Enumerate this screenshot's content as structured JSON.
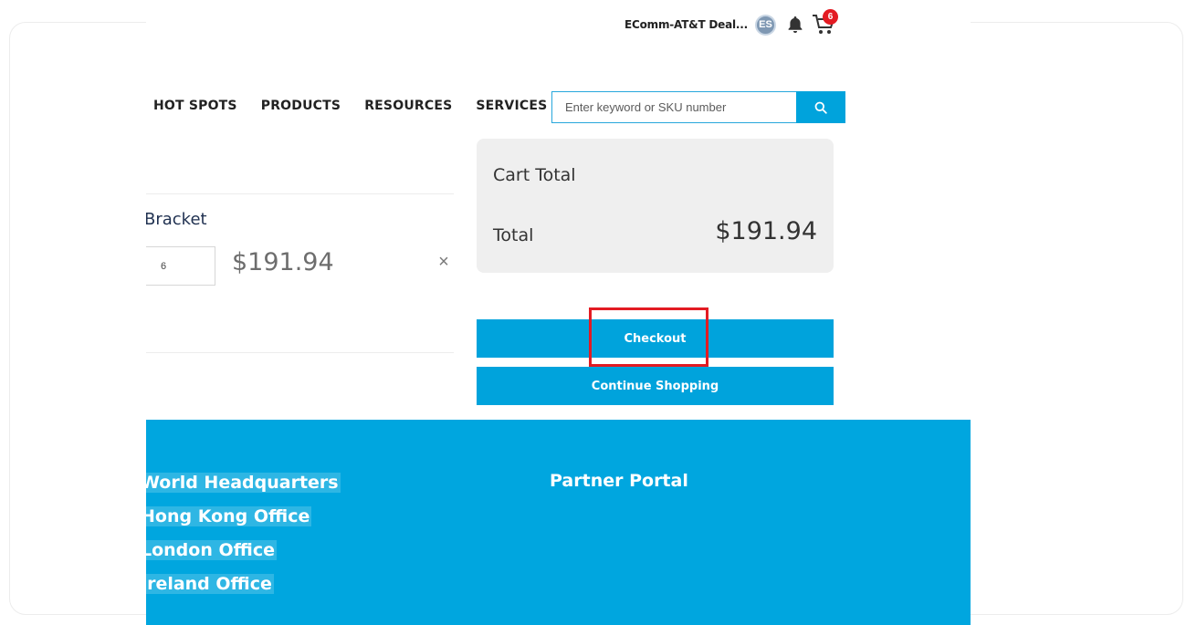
{
  "header": {
    "account_name": "EComm-AT&T Deal...",
    "avatar_initials": "ES",
    "cart_count": "6"
  },
  "nav": {
    "items": [
      {
        "label": "HOT SPOTS"
      },
      {
        "label": "PRODUCTS"
      },
      {
        "label": "RESOURCES"
      },
      {
        "label": "SERVICES"
      }
    ]
  },
  "search": {
    "placeholder": "Enter keyword or SKU number"
  },
  "cart_item": {
    "name": "Bracket",
    "quantity": "6",
    "price": "$191.94",
    "remove_glyph": "×"
  },
  "summary": {
    "title": "Cart Total",
    "total_label": "Total",
    "total_value": "$191.94"
  },
  "actions": {
    "checkout": "Checkout",
    "continue": "Continue Shopping"
  },
  "footer": {
    "left_links": [
      "World Headquarters",
      "Hong Kong Office",
      "London Office",
      "Ireland Office"
    ],
    "right_heading": "Partner Portal"
  },
  "colors": {
    "accent": "#00a3dc",
    "highlight": "#e31b23"
  }
}
